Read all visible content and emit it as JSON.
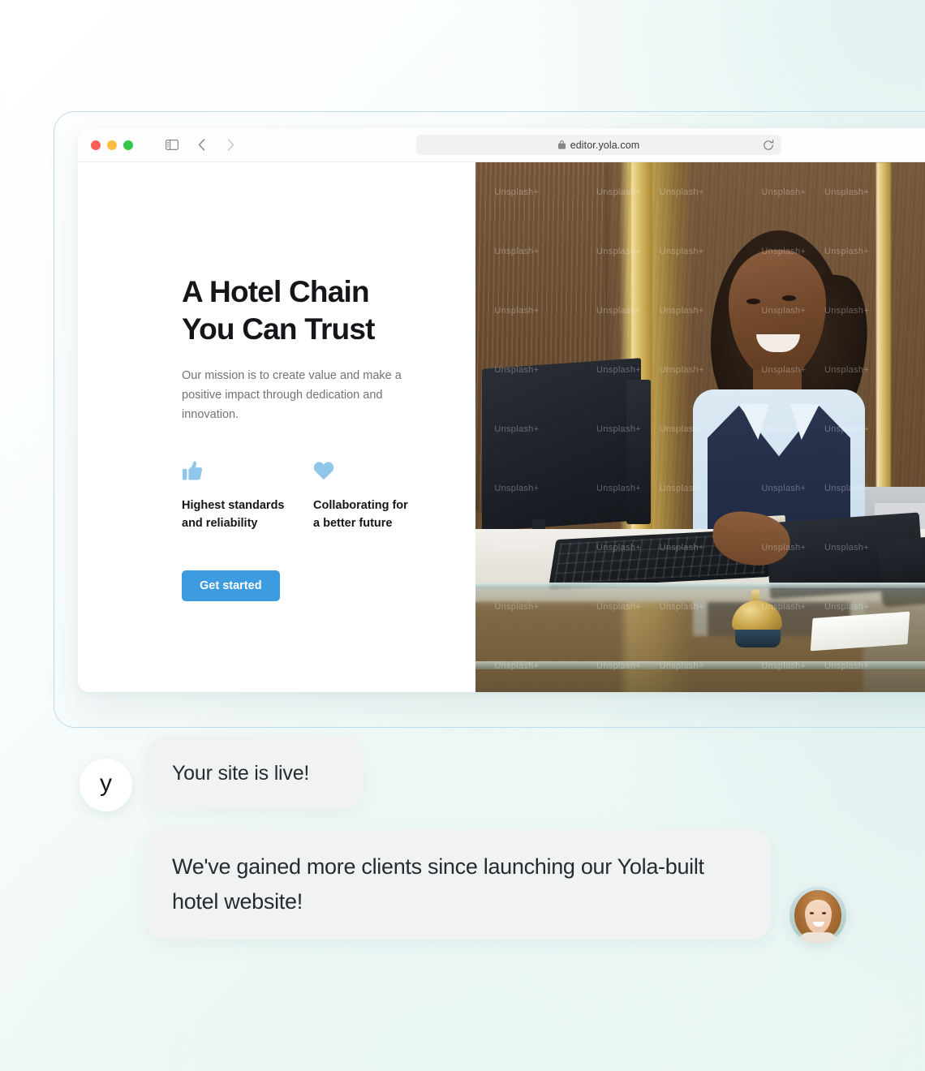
{
  "browser": {
    "traffic_lights": [
      {
        "name": "close",
        "color": "#FC6058"
      },
      {
        "name": "minimize",
        "color": "#FDBC40"
      },
      {
        "name": "maximize",
        "color": "#34C749"
      }
    ],
    "sidebar_toggle_icon": "sidebar-icon",
    "back_icon": "chevron-left-icon",
    "forward_icon": "chevron-right-icon",
    "shield_icon": "privacy-shield-icon",
    "lock_icon": "lock-icon",
    "url": "editor.yola.com",
    "reload_icon": "reload-icon"
  },
  "site": {
    "hero": {
      "title": "A Hotel Chain\nYou Can Trust",
      "subtitle": "Our mission is to create value and make a positive impact through dedication and innovation.",
      "cta_label": "Get started"
    },
    "features": [
      {
        "icon": "thumbs-up-icon",
        "label": "Highest standards\nand reliability"
      },
      {
        "icon": "heart-icon",
        "label": "Collaborating for\na better future"
      }
    ],
    "hero_image": {
      "alt": "Smiling hotel receptionist in navy vest typing at a front desk with a gold service bell",
      "watermark": "Unsplash+"
    }
  },
  "chat": {
    "messages": [
      {
        "avatar_type": "logo",
        "avatar_label": "y",
        "text": "Your site is live!"
      },
      {
        "avatar_type": "photo",
        "avatar_alt": "Smiling woman with auburn hair",
        "text": "We've gained more clients since launching our Yola-built hotel website!"
      }
    ]
  },
  "colors": {
    "accent_blue": "#3D9BE0",
    "feature_icon_blue": "#8FC6E9",
    "bubble_bg": "#F1F3F3",
    "text_dark": "#15161A",
    "text_muted": "#70737A",
    "frame_border": "#BFDFEE"
  }
}
